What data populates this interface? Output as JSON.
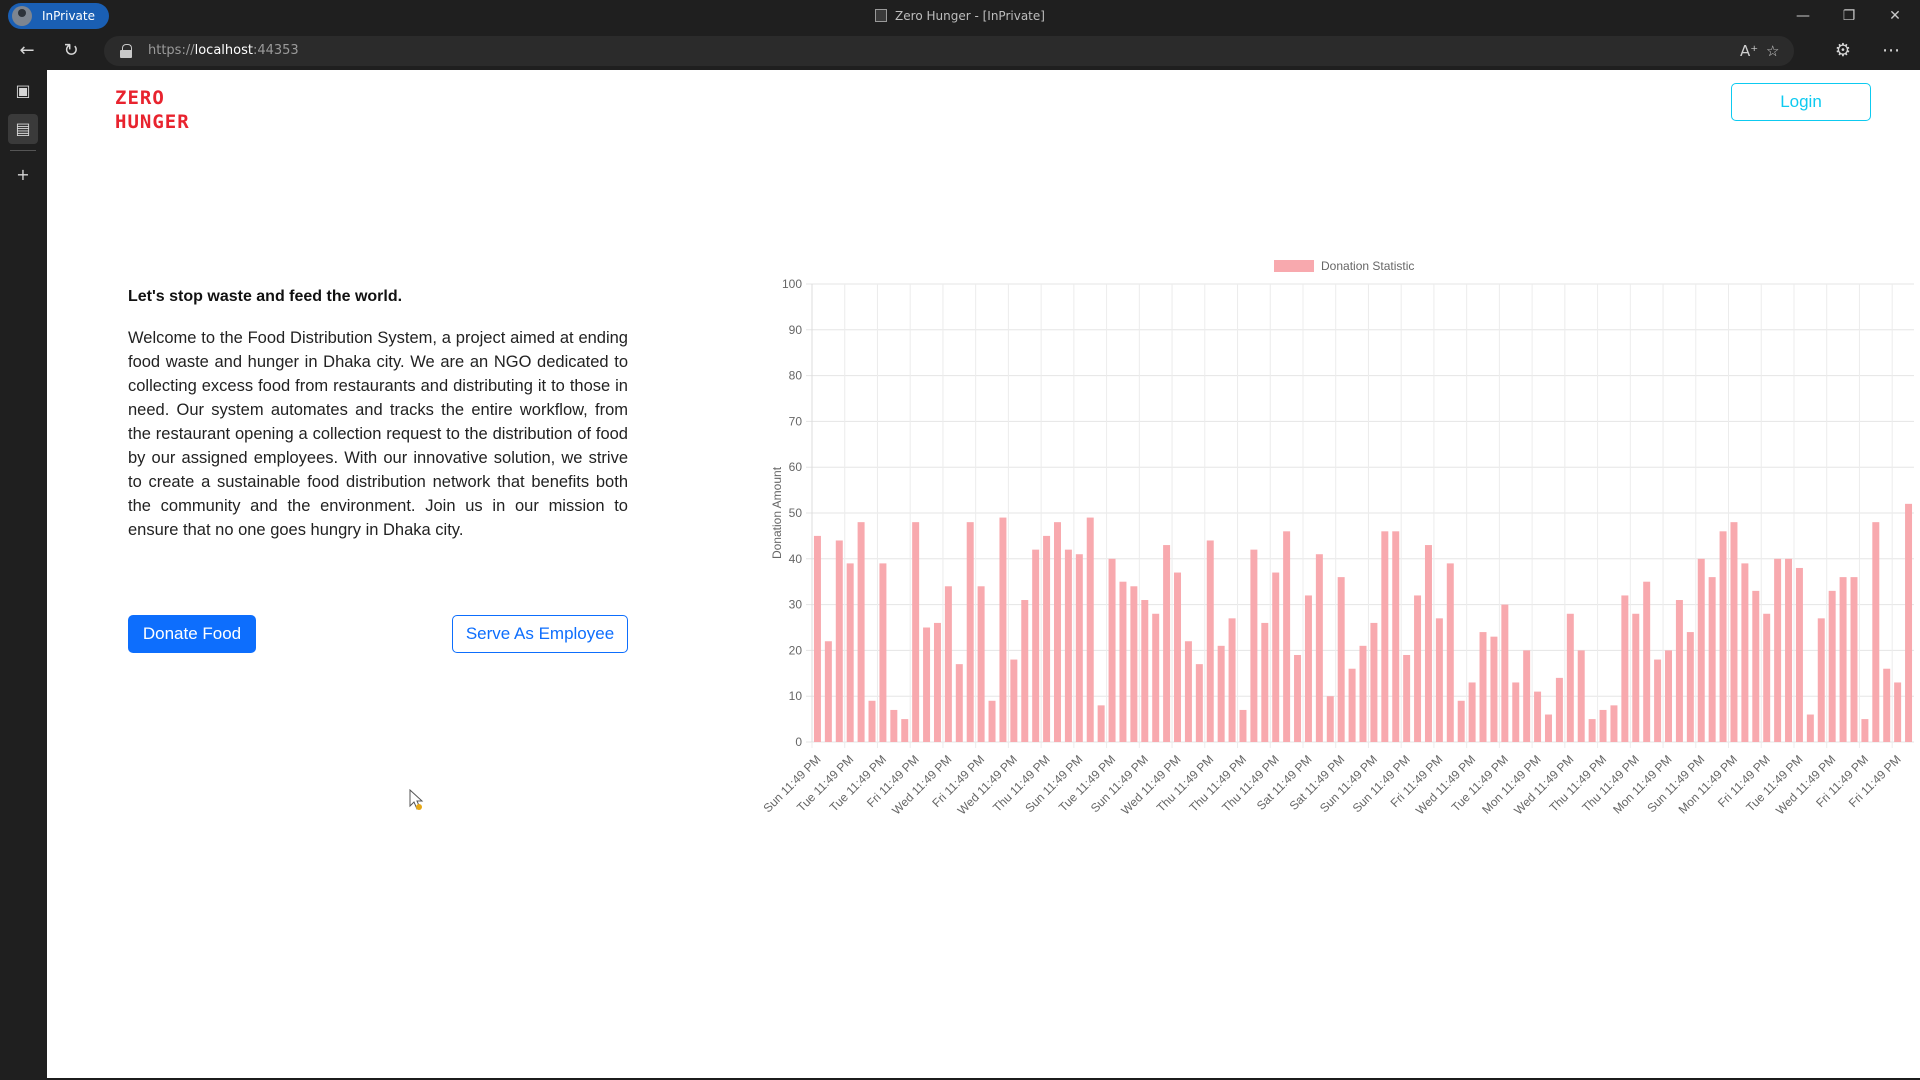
{
  "browser": {
    "inprivate_label": "InPrivate",
    "window_title": "Zero Hunger - [InPrivate]",
    "url_scheme": "https://",
    "url_host": "localhost",
    "url_port": ":44353"
  },
  "header": {
    "logo_line1": "ZERO",
    "logo_line2": "HUNGER",
    "login_label": "Login"
  },
  "hero": {
    "headline": "Let's stop waste and feed the world.",
    "intro": "Welcome to the Food Distribution System, a project aimed at ending food waste and hunger in Dhaka city. We are an NGO dedicated to collecting excess food from restaurants and distributing it to those in need. Our system automates and tracks the entire workflow, from the restaurant opening a collection request to the distribution of food by our assigned employees. With our innovative solution, we strive to create a sustainable food distribution network that benefits both the community and the environment. Join us in our mission to ensure that no one goes hungry in Dhaka city.",
    "donate_label": "Donate Food",
    "employee_label": "Serve As Employee"
  },
  "colors": {
    "brand": "#e8232e",
    "primary": "#0d6efd",
    "login_accent": "#0dcaf0",
    "bar_fill": "#f8a9ae"
  },
  "chart_data": {
    "type": "bar",
    "ylabel": "Donation Amount",
    "ylim": [
      0,
      100
    ],
    "yticks": [
      0,
      10,
      20,
      30,
      40,
      50,
      60,
      70,
      80,
      90,
      100
    ],
    "grid": true,
    "legend_position": "top",
    "categories": [
      "Sun 11:49 PM",
      "Tue 11:49 PM",
      "Tue 11:49 PM",
      "Fri 11:49 PM",
      "Wed 11:49 PM",
      "Fri 11:49 PM",
      "Wed 11:49 PM",
      "Thu 11:49 PM",
      "Sun 11:49 PM",
      "Tue 11:49 PM",
      "Sun 11:49 PM",
      "Wed 11:49 PM",
      "Thu 11:49 PM",
      "Thu 11:49 PM",
      "Thu 11:49 PM",
      "Sat 11:49 PM",
      "Sat 11:49 PM",
      "Sun 11:49 PM",
      "Sun 11:49 PM",
      "Fri 11:49 PM",
      "Wed 11:49 PM",
      "Tue 11:49 PM",
      "Mon 11:49 PM",
      "Wed 11:49 PM",
      "Thu 11:49 PM",
      "Thu 11:49 PM",
      "Mon 11:49 PM",
      "Sun 11:49 PM",
      "Mon 11:49 PM",
      "Fri 11:49 PM",
      "Tue 11:49 PM",
      "Wed 11:49 PM",
      "Fri 11:49 PM",
      "Fri 11:49 PM"
    ],
    "series": [
      {
        "name": "Donation Statistic",
        "values": [
          45,
          22,
          44,
          39,
          48,
          9,
          39,
          7,
          5,
          48,
          25,
          26,
          34,
          17,
          48,
          34,
          9,
          49,
          18,
          31,
          42,
          45,
          48,
          42,
          41,
          49,
          8,
          40,
          35,
          34,
          31,
          28,
          43,
          37,
          22,
          17,
          44,
          21,
          27,
          7,
          42,
          26,
          37,
          46,
          19,
          32,
          41,
          10,
          36,
          16,
          21,
          26,
          46,
          46,
          19,
          32,
          43,
          27,
          39,
          9,
          13,
          24,
          23,
          30,
          13,
          20,
          11,
          6,
          14,
          28,
          20,
          5,
          7,
          8,
          32,
          28,
          35,
          18,
          20,
          31,
          24,
          40,
          36,
          46,
          48,
          39,
          33,
          28,
          40,
          40,
          38,
          6,
          27,
          33,
          36,
          36,
          5,
          48,
          16,
          13,
          52
        ]
      }
    ]
  }
}
